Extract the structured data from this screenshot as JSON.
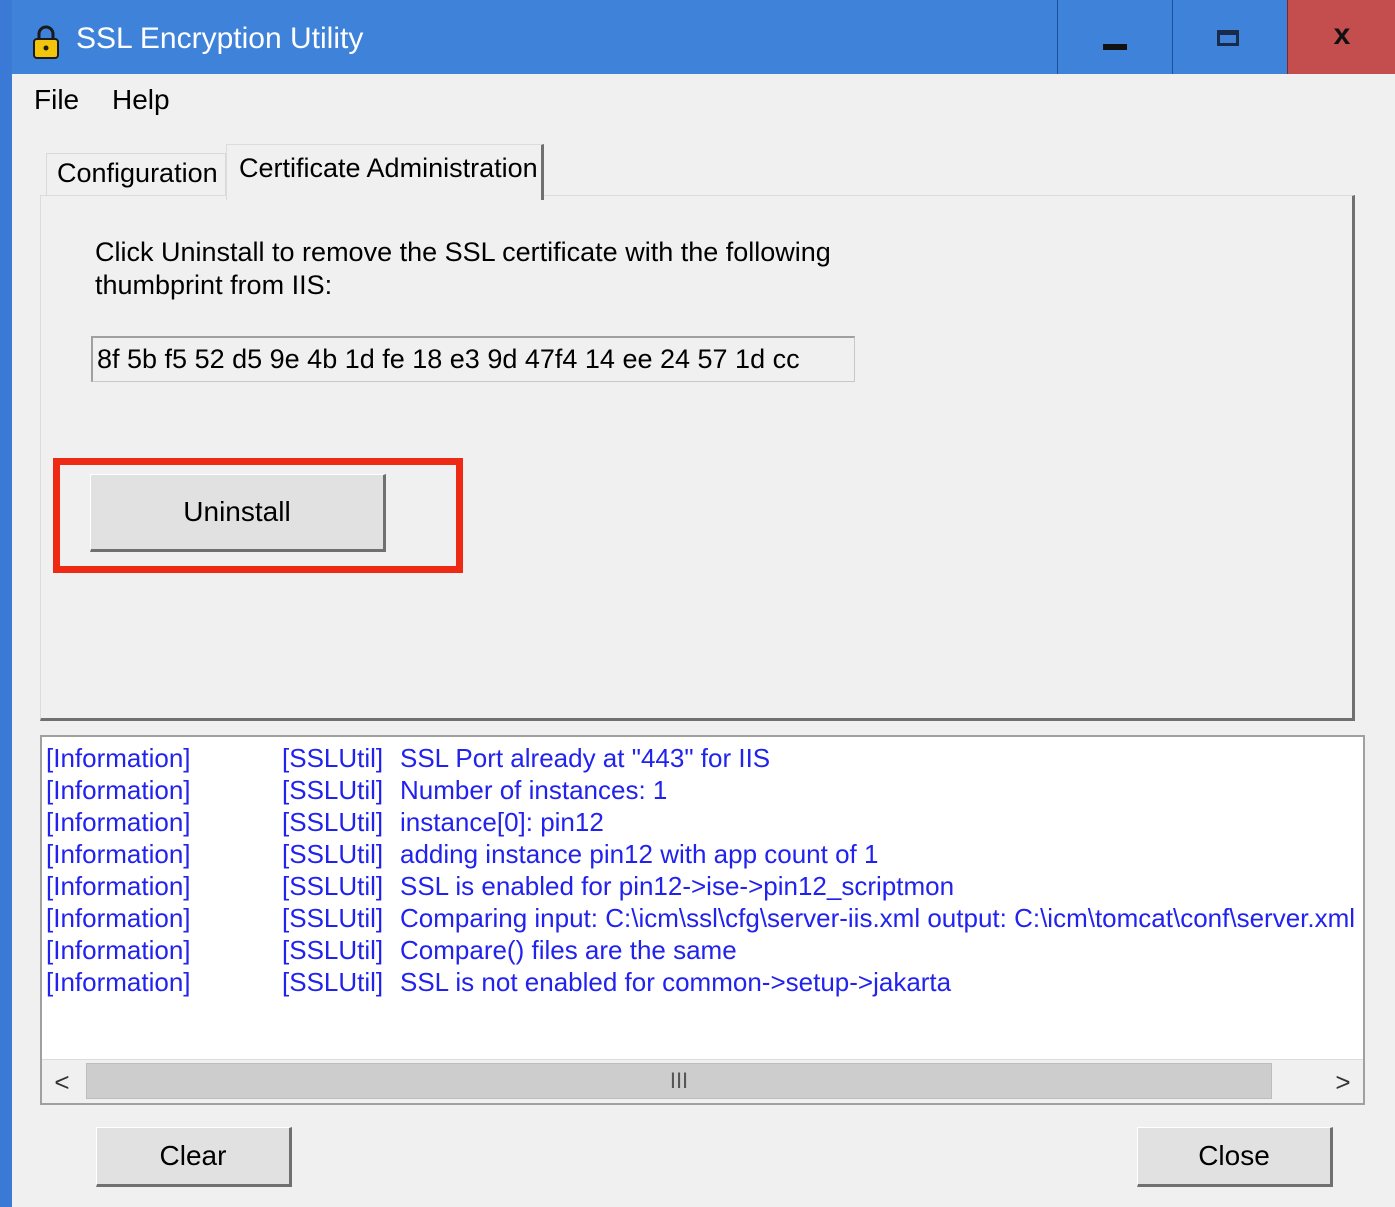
{
  "window": {
    "title": "SSL Encryption Utility",
    "close_glyph": "x"
  },
  "menu": {
    "file": "File",
    "help": "Help"
  },
  "tabs": [
    {
      "label": "Configuration",
      "active": false
    },
    {
      "label": "Certificate Administration",
      "active": true
    }
  ],
  "panel": {
    "instruction": "Click Uninstall to remove the SSL certificate with the following thumbprint from IIS:",
    "thumbprint": "8f 5b f5 52 d5 9e 4b 1d fe 18 e3 9d 47f4 14 ee 24 57 1d cc",
    "uninstall_label": "Uninstall"
  },
  "log": {
    "rows": [
      {
        "level": "[Information]",
        "source": "[SSLUtil]",
        "message": "SSL Port already at \"443\" for IIS"
      },
      {
        "level": "[Information]",
        "source": "[SSLUtil]",
        "message": "Number of instances: 1"
      },
      {
        "level": "[Information]",
        "source": "[SSLUtil]",
        "message": "instance[0]: pin12"
      },
      {
        "level": "[Information]",
        "source": "[SSLUtil]",
        "message": "adding instance pin12 with app count of 1"
      },
      {
        "level": "[Information]",
        "source": "[SSLUtil]",
        "message": "SSL is enabled for pin12->ise->pin12_scriptmon"
      },
      {
        "level": "[Information]",
        "source": "[SSLUtil]",
        "message": "Comparing input: C:\\icm\\ssl\\cfg\\server-iis.xml output: C:\\icm\\tomcat\\conf\\server.xml"
      },
      {
        "level": "[Information]",
        "source": "[SSLUtil]",
        "message": "Compare() files are the same"
      },
      {
        "level": "[Information]",
        "source": "[SSLUtil]",
        "message": "SSL is not enabled for common->setup->jakarta"
      }
    ],
    "scroll_left": "<",
    "scroll_right": ">",
    "scroll_grip": "III"
  },
  "buttons": {
    "clear": "Clear",
    "close": "Close"
  },
  "colors": {
    "titlebar": "#3f82d9",
    "close_button": "#c44d4d",
    "highlight": "#ee2a14",
    "log_text": "#2222ee"
  },
  "icons": {
    "app": "padlock-icon",
    "minimize": "minimize-icon",
    "maximize": "maximize-icon",
    "close": "close-icon"
  }
}
